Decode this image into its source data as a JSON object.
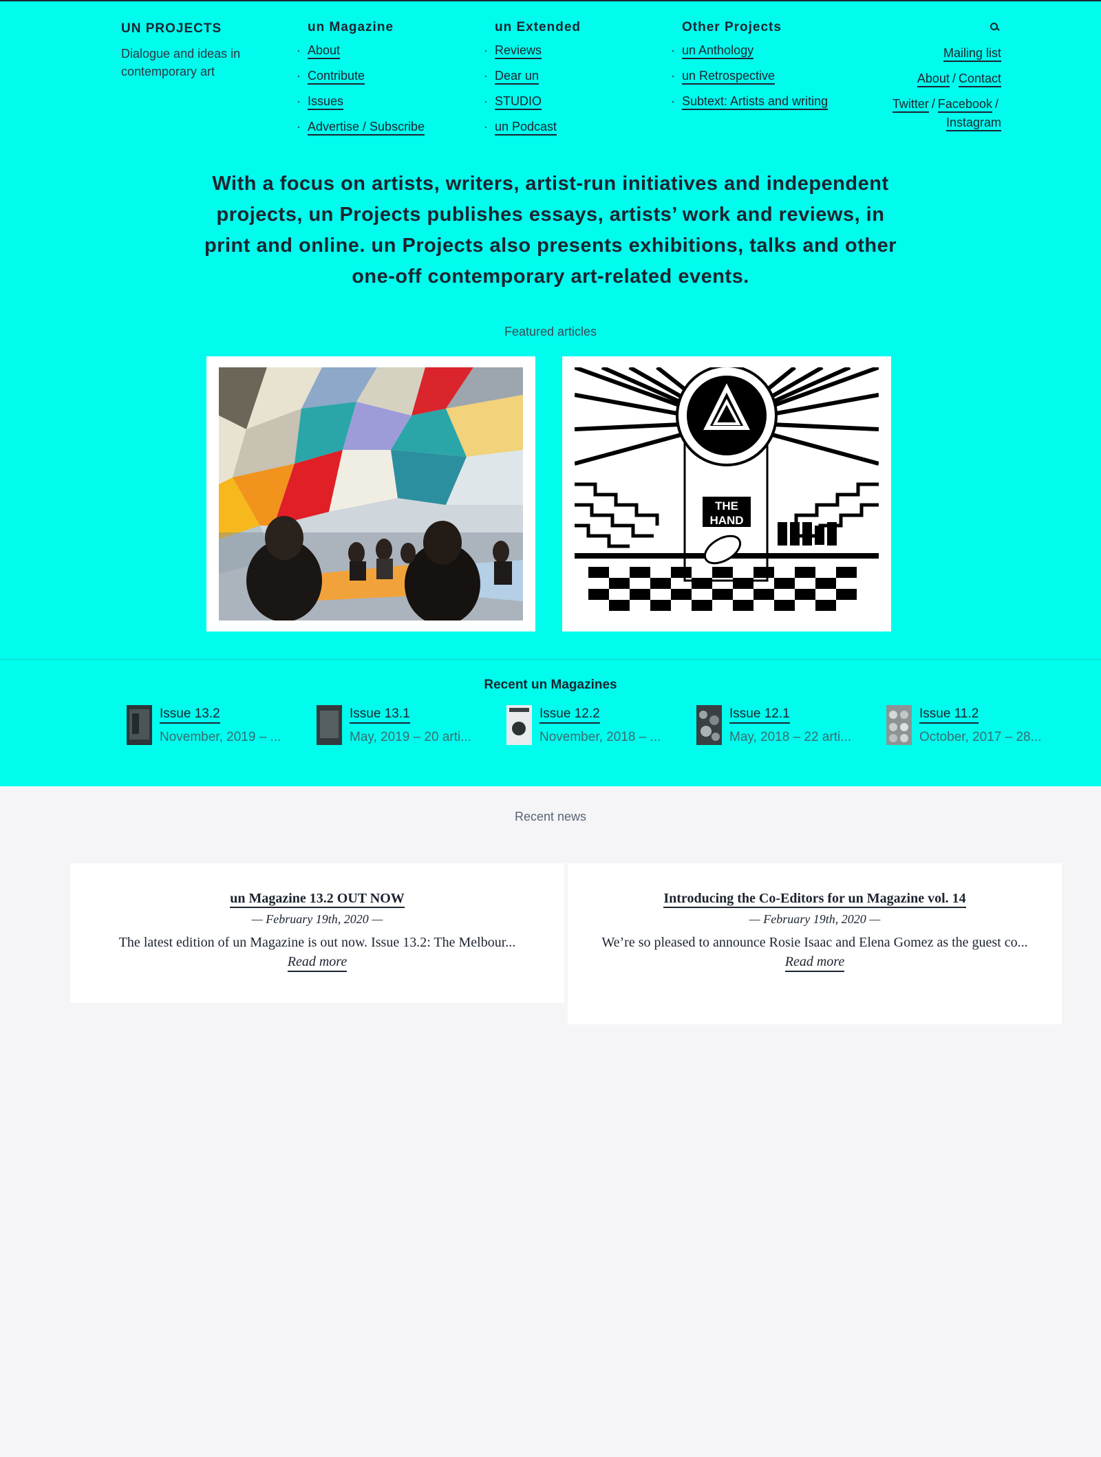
{
  "brand": {
    "title": "UN PROJECTS",
    "subtitle": "Dialogue and ideas in contemporary art"
  },
  "nav": {
    "col1": {
      "heading": "un Magazine",
      "items": [
        "About",
        "Contribute",
        "Issues",
        "Advertise / Subscribe"
      ]
    },
    "col2": {
      "heading": "un Extended",
      "items": [
        "Reviews",
        "Dear un",
        "STUDIO",
        "un Podcast"
      ]
    },
    "col3": {
      "heading": "Other Projects",
      "items": [
        "un Anthology",
        "un Retrospective",
        "Subtext: Artists and writing"
      ]
    },
    "right": {
      "mailing": "Mailing list",
      "about": "About",
      "contact": "Contact",
      "twitter": "Twitter",
      "facebook": "Facebook",
      "instagram": "Instagram",
      "slash": "/"
    }
  },
  "intro": "With a focus on artists, writers, artist-run initiatives and independent projects, un Projects publishes essays, artists’ work and reviews, in print and online. un Projects also presents exhibitions, talks and other one-off contemporary art-related events.",
  "featured": {
    "title": "Featured articles",
    "hand_text_1": "THE",
    "hand_text_2": "HAND"
  },
  "magazines": {
    "title": "Recent un Magazines",
    "items": [
      {
        "title": "Issue 13.2",
        "sub": "November, 2019 – ..."
      },
      {
        "title": "Issue 13.1",
        "sub": "May, 2019 – 20 arti..."
      },
      {
        "title": "Issue 12.2",
        "sub": "November, 2018 – ..."
      },
      {
        "title": "Issue 12.1",
        "sub": "May, 2018 – 22 arti..."
      },
      {
        "title": "Issue 11.2",
        "sub": "October, 2017 – 28..."
      }
    ]
  },
  "news": {
    "title": "Recent news",
    "items": [
      {
        "title": "un Magazine 13.2 OUT NOW",
        "date": "— February 19th, 2020 —",
        "excerpt": "The latest edition of un Magazine is out now. Issue 13.2: The Melbour...",
        "more": "Read more"
      },
      {
        "title": "Introducing the Co-Editors for un Magazine vol. 14",
        "date": "— February 19th, 2020 —",
        "excerpt": "We’re so pleased to announce Rosie Isaac and Elena Gomez as the guest co...",
        "more": "Read more"
      }
    ]
  },
  "colors": {
    "accent": "#00fced",
    "text": "#1c2430",
    "page_bg": "#f5f5f8"
  }
}
